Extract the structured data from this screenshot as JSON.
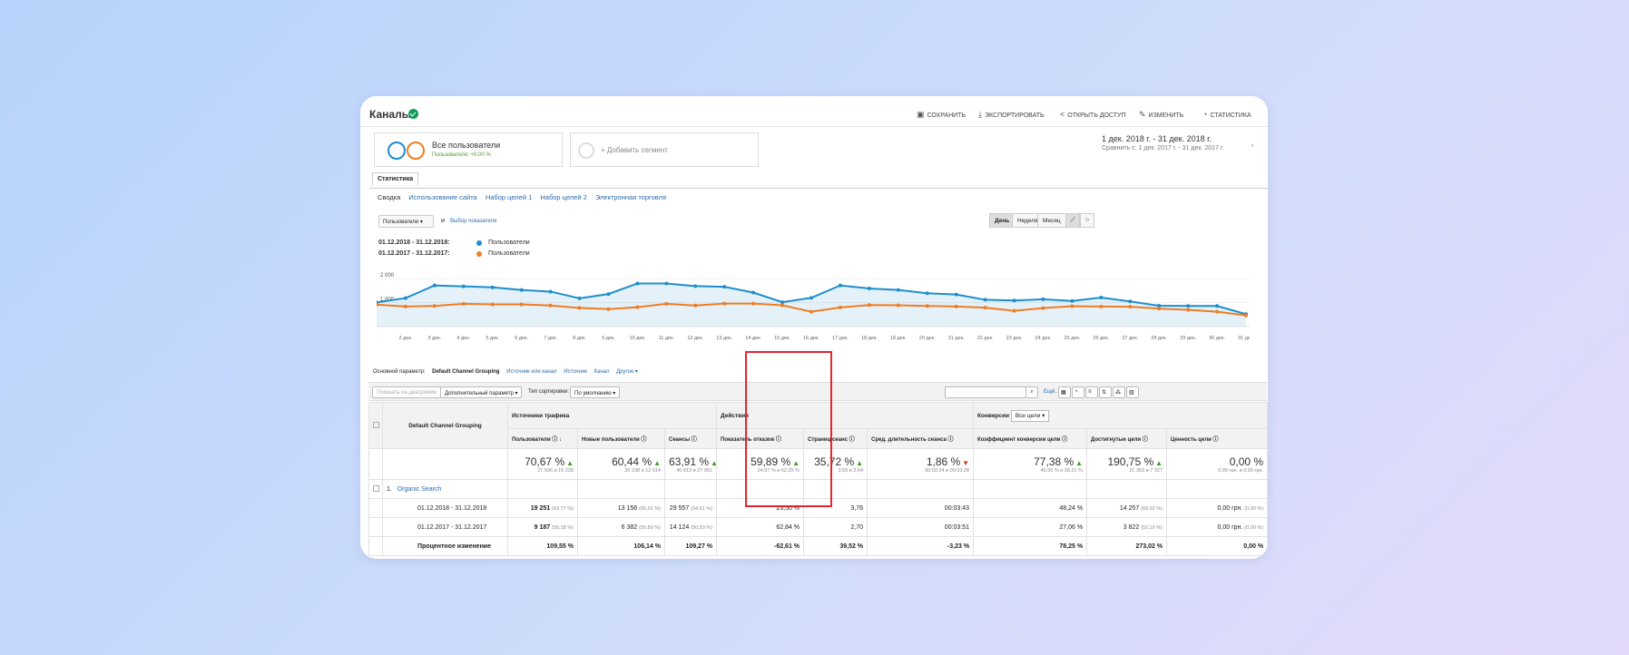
{
  "title": "Каналы",
  "toolbar": {
    "save": "СОХРАНИТЬ",
    "export": "ЭКСПОРТИРОВАТЬ",
    "share": "ОТКРЫТЬ ДОСТУП",
    "edit": "ИЗМЕНИТЬ",
    "insights": "СТАТИСТИКА",
    "insights_badge": "3"
  },
  "segments": {
    "active_name": "Все пользователи",
    "active_sub": "Пользователи: +0,00 %",
    "add": "+ Добавить сегмент"
  },
  "date_range": {
    "main": "1 дек. 2018 г. - 31 дек. 2018 г.",
    "compare": "Сравнить с: 1 дек. 2017 г. - 31 дек. 2017 г."
  },
  "report_tab": "Статистика",
  "subtabs": [
    "Сводка",
    "Использование сайта",
    "Набор целей 1",
    "Набор целей 2",
    "Электронная торговля"
  ],
  "chart_controls": {
    "metric": "Пользователи",
    "and": "и",
    "select_metric": "Выбор показателя",
    "periods": [
      "День",
      "Неделя",
      "Месяц"
    ]
  },
  "legend": [
    {
      "date": "01.12.2018 - 31.12.2018:",
      "name": "Пользователи",
      "color": "#1e8ecb"
    },
    {
      "date": "01.12.2017 - 31.12.2017:",
      "name": "Пользователи",
      "color": "#ef7d22"
    }
  ],
  "chart_data": {
    "type": "line",
    "y_ticks": [
      "2 000",
      "1 000"
    ],
    "ylim": [
      0,
      2500
    ],
    "x": [
      "",
      "2 дек.",
      "3 дек.",
      "4 дек.",
      "5 дек.",
      "6 дек.",
      "7 дек.",
      "8 дек.",
      "9 дек.",
      "10 дек.",
      "11 дек.",
      "12 дек.",
      "13 дек.",
      "14 дек.",
      "15 дек.",
      "16 дек.",
      "17 дек.",
      "18 дек.",
      "19 дек.",
      "20 дек.",
      "21 дек.",
      "22 дек.",
      "23 дек.",
      "24 дек.",
      "25 дек.",
      "26 дек.",
      "27 дек.",
      "28 дек.",
      "29 дек.",
      "30 дек.",
      "31 дек."
    ],
    "series": [
      {
        "name": "Пользователи",
        "color": "#1e8ecb",
        "values": [
          1010,
          1190,
          1720,
          1680,
          1640,
          1530,
          1460,
          1180,
          1360,
          1800,
          1800,
          1690,
          1660,
          1420,
          1020,
          1200,
          1720,
          1590,
          1530,
          1390,
          1340,
          1120,
          1090,
          1140,
          1070,
          1210,
          1050,
          870,
          860,
          860,
          520
        ],
        "fill": true
      },
      {
        "name": "Пользователи",
        "color": "#ef7d22",
        "values": [
          920,
          840,
          860,
          950,
          930,
          930,
          880,
          780,
          730,
          810,
          950,
          880,
          960,
          960,
          890,
          620,
          800,
          900,
          890,
          860,
          840,
          790,
          660,
          770,
          850,
          840,
          830,
          750,
          700,
          620,
          470
        ]
      }
    ]
  },
  "dimensions": {
    "primary_label": "Основной параметр:",
    "primary": "Default Channel Grouping",
    "options": [
      "Источник или канал",
      "Источник",
      "Канал",
      "Другое ▾"
    ]
  },
  "table_tools": {
    "plot_rows": "Показать на диаграмме",
    "secondary": "Дополнительный параметр",
    "sort_label": "Тип сортировки:",
    "sort": "По умолчанию",
    "more": "Ещё..."
  },
  "table": {
    "dim_header": "Default Channel Grouping",
    "groups": [
      "Источники трафика",
      "Действия",
      "Конверсии"
    ],
    "conv_select": "Все цели",
    "columns": [
      "Пользователи",
      "Новые пользователи",
      "Сеансы",
      "Показатель отказов",
      "Страниц/сеанс",
      "Сред. длительность сеанса",
      "Коэффициент конверсии цели",
      "Достигнутые цели",
      "Ценность цели"
    ],
    "totals": [
      {
        "v": "70,67 %",
        "s": "27 696 и 16 228",
        "t": "up"
      },
      {
        "v": "60,44 %",
        "s": "20 238 и 12 614",
        "t": "up"
      },
      {
        "v": "63,91 %",
        "s": "45 813 и 27 951",
        "t": "up"
      },
      {
        "v": "59,89 %",
        "s": "24,97 % и 62,25 %",
        "t": "up"
      },
      {
        "v": "35,72 %",
        "s": "3,59 и 2,64",
        "t": "up"
      },
      {
        "v": "1,86 %",
        "s": "00:03:24 и 00:03:28",
        "t": "down"
      },
      {
        "v": "77,38 %",
        "s": "46,50 % и 26,21 %",
        "t": "up"
      },
      {
        "v": "190,75 %",
        "s": "21 303 и 7 327",
        "t": "up"
      },
      {
        "v": "0,00 %",
        "s": "0,00 грн. и 0,00 грн.",
        "t": "none"
      }
    ],
    "group_row": {
      "index": "1.",
      "name": "Organic Search"
    },
    "rows": [
      {
        "label": "01.12.2018 - 31.12.2018",
        "cells": [
          [
            "19 251",
            "(63,77 %)"
          ],
          [
            "13 156",
            "(65,01 %)"
          ],
          [
            "29 557",
            "(64,51 %)"
          ],
          [
            "23,50 %",
            ""
          ],
          [
            "3,76",
            ""
          ],
          [
            "00:03:43",
            ""
          ],
          [
            "48,24 %",
            ""
          ],
          [
            "14 257",
            "(66,92 %)"
          ],
          [
            "0,00 грн.",
            "(0,00 %)"
          ]
        ],
        "bold_first": true
      },
      {
        "label": "01.12.2017 - 31.12.2017",
        "cells": [
          [
            "9 187",
            "(50,18 %)"
          ],
          [
            "6 382",
            "(50,59 %)"
          ],
          [
            "14 124",
            "(50,53 %)"
          ],
          [
            "62,84 %",
            ""
          ],
          [
            "2,70",
            ""
          ],
          [
            "00:03:51",
            ""
          ],
          [
            "27,06 %",
            ""
          ],
          [
            "3 822",
            "(52,16 %)"
          ],
          [
            "0,00 грн.",
            "(0,00 %)"
          ]
        ],
        "bold_first": true
      },
      {
        "label": "Процентное изменение",
        "cells": [
          [
            "109,55 %",
            ""
          ],
          [
            "106,14 %",
            ""
          ],
          [
            "109,27 %",
            ""
          ],
          [
            "-62,61 %",
            ""
          ],
          [
            "39,52 %",
            ""
          ],
          [
            "-3,23 %",
            ""
          ],
          [
            "78,25 %",
            ""
          ],
          [
            "273,02 %",
            ""
          ],
          [
            "0,00 %",
            ""
          ]
        ],
        "bold_all": true
      }
    ]
  }
}
